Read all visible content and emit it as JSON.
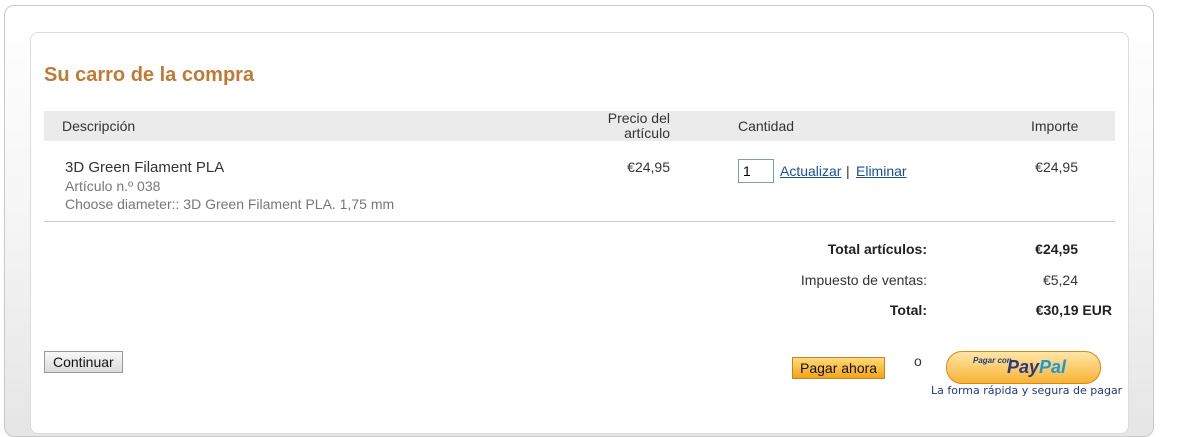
{
  "cart": {
    "title": "Su carro de la compra",
    "headers": {
      "description": "Descripción",
      "price": "Precio del artículo",
      "quantity": "Cantidad",
      "amount": "Importe"
    },
    "items": [
      {
        "name": "3D Green Filament PLA",
        "article": "Artículo n.º 038",
        "option": "Choose diameter:: 3D Green Filament PLA. 1,75 mm",
        "price": "€24,95",
        "quantity": "1",
        "update_label": "Actualizar",
        "separator": "|",
        "remove_label": " Eliminar",
        "amount": "€24,95"
      }
    ],
    "totals": {
      "items_label": "Total artículos:",
      "items_value": "€24,95",
      "tax_label": "Impuesto de ventas:",
      "tax_value": "€5,24",
      "total_label": "Total:",
      "total_value": "€30,19 EUR"
    },
    "actions": {
      "continue_label": "Continuar",
      "pay_now_label": "Pagar ahora",
      "or_label": "o",
      "paypal_small": "Pagar con",
      "paypal_brand_pay": "Pay",
      "paypal_brand_pal": "Pal",
      "paypal_tagline": "La forma rápida y segura de pagar"
    }
  }
}
